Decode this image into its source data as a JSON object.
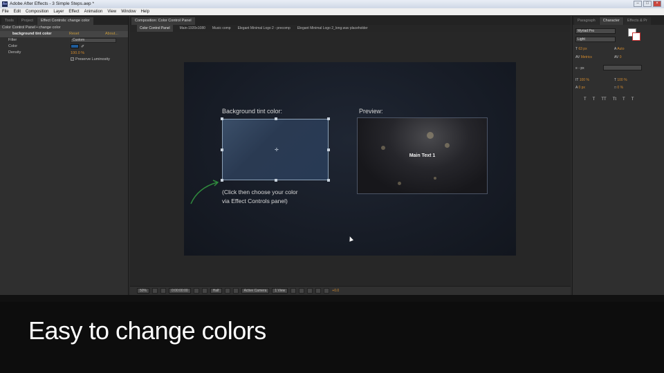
{
  "titlebar": {
    "app_icon": "Ae",
    "title": "Adobe After Effects - 3 Simple Steps.aep *"
  },
  "menu": [
    "File",
    "Edit",
    "Composition",
    "Layer",
    "Effect",
    "Animation",
    "View",
    "Window",
    "Help"
  ],
  "left_panel": {
    "tabs": [
      "Tools",
      "Project",
      "Effect Controls: change color"
    ],
    "subheader": "Color Control Panel • change color",
    "effect": {
      "name": "background tint color",
      "reset": "Reset",
      "about": "About...",
      "filter_label": "Filter",
      "filter_value": "Custom",
      "color_label": "Color",
      "density_label": "Density",
      "density_value": "100.0 %",
      "preserve_label": "Preserve Luminosity",
      "preserve_checked": true
    }
  },
  "comp_panel": {
    "tab": "Composition: Color Control Panel",
    "breadcrumbs": [
      "Color Control Panel",
      "Main-1920x1080",
      "Music comp",
      "Elegant Minimal Logo 2 - precomp",
      "Elegant Minimal Logo 2_long.wav placeholder"
    ],
    "canvas": {
      "bg_tint_label": "Background tint color:",
      "preview_label": "Preview:",
      "preview_text": "Main Text 1",
      "hint_line1": "(Click then choose your color",
      "hint_line2": "via Effect Controls panel)"
    },
    "toolbar": {
      "zoom": "50%",
      "timecode": "0:00:00:00",
      "resolution": "Half",
      "camera": "Active Camera",
      "views": "1 View",
      "exposure": "+0.0"
    }
  },
  "right_panel": {
    "tabs": [
      "Paragraph",
      "Character",
      "Effects & Pr"
    ],
    "font": "Myriad Pro",
    "style": "Light",
    "size": "63 px",
    "leading": "Auto",
    "kerning": "Metrics",
    "tracking": "0",
    "stroke": "- px",
    "vscale": "100 %",
    "hscale": "100 %",
    "baseline": "0 px",
    "tsume": "0 %",
    "format_buttons": [
      "T",
      "T",
      "TT",
      "Tt",
      "T",
      "T"
    ]
  },
  "caption": "Easy to change colors",
  "colors": {
    "accent": "#d38a2d",
    "tint_swatch": "#1f5c9a"
  }
}
